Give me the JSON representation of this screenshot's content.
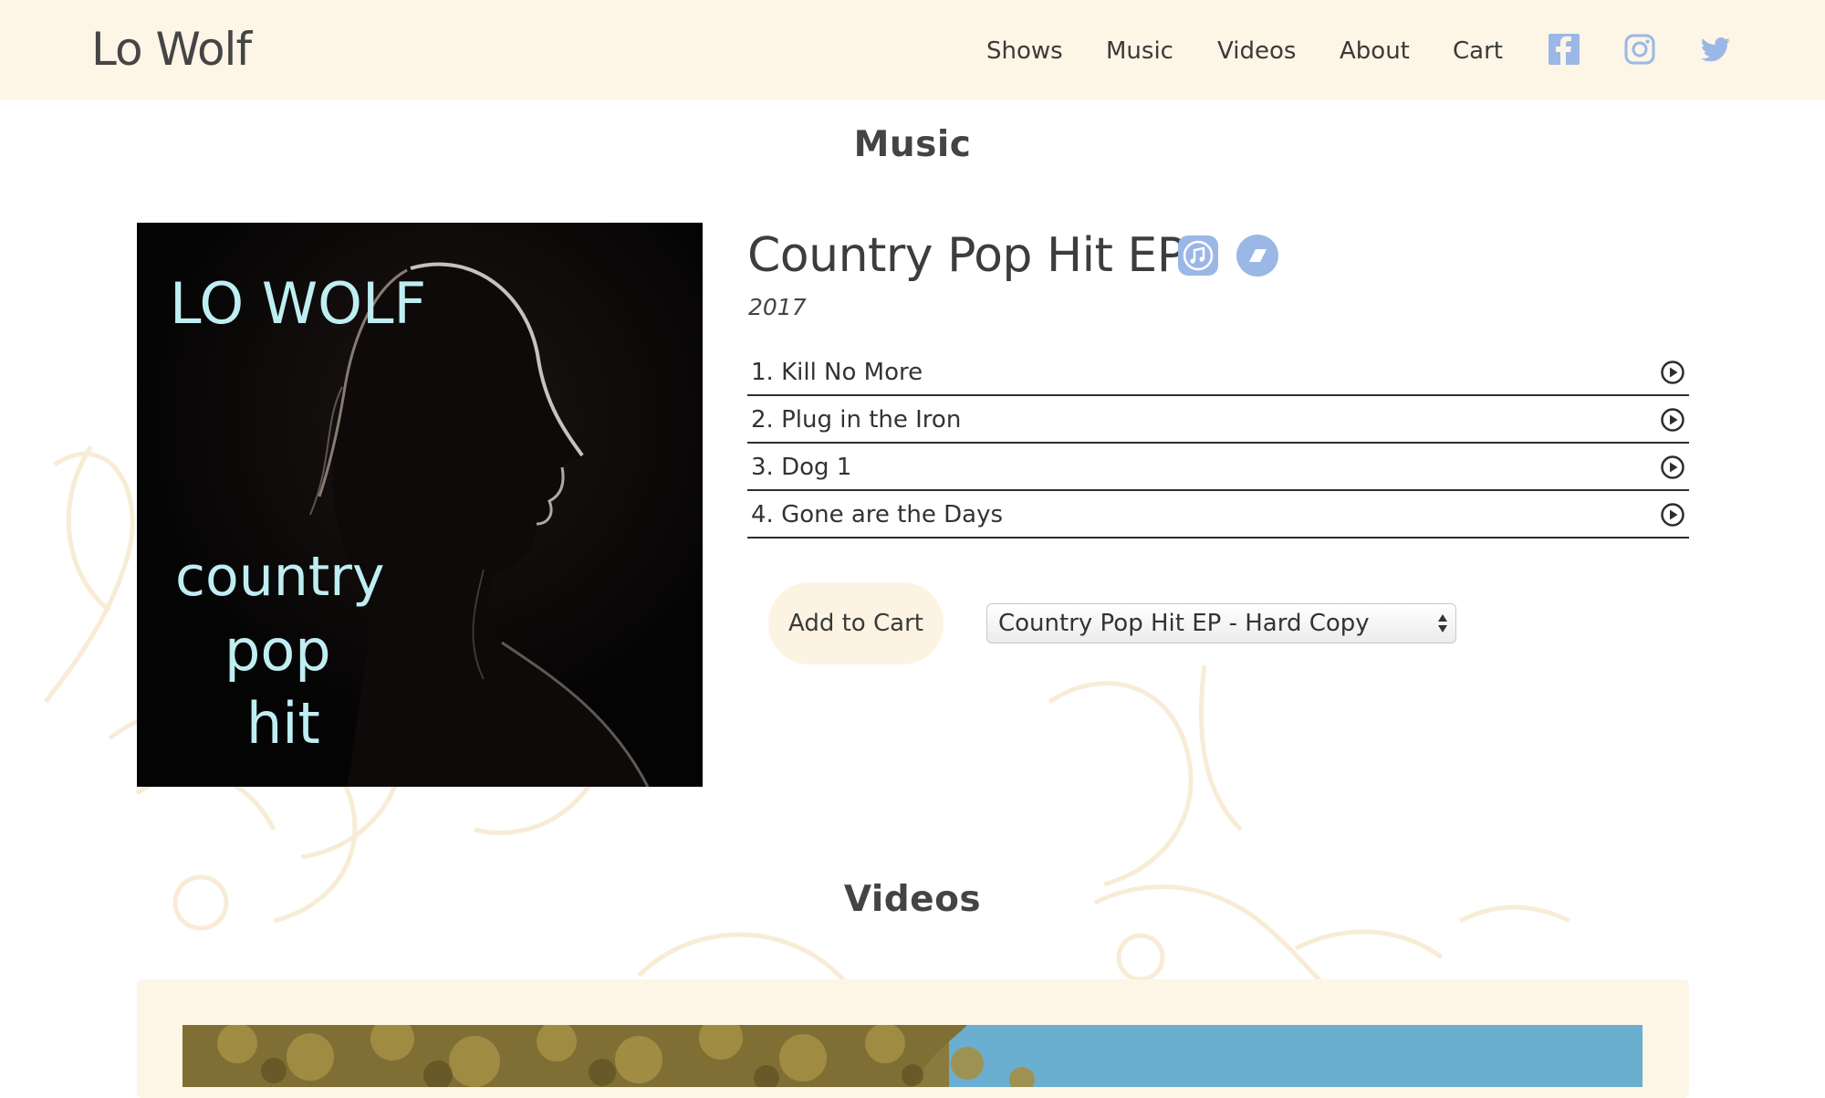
{
  "header": {
    "site_title": "Lo Wolf",
    "nav": [
      "Shows",
      "Music",
      "Videos",
      "About",
      "Cart"
    ],
    "social": [
      "facebook-icon",
      "instagram-icon",
      "twitter-icon"
    ]
  },
  "music": {
    "section_title": "Music",
    "album": {
      "cover_text": {
        "artist": "LO WOLF",
        "line1": "country",
        "line2": "pop",
        "line3": "hit"
      },
      "title": "Country Pop Hit EP",
      "year": "2017",
      "badges": [
        "itunes-icon",
        "bandcamp-icon"
      ],
      "tracks": [
        "1. Kill No More",
        "2. Plug in the Iron",
        "3. Dog 1",
        "4. Gone are the Days"
      ],
      "add_to_cart": "Add to Cart",
      "product_select": "Country Pop Hit EP - Hard Copy"
    }
  },
  "videos": {
    "section_title": "Videos"
  },
  "colors": {
    "header_bg": "#fdf5e6",
    "icon_blue": "#9bb7e6",
    "cover_text": "#bfeef2"
  }
}
